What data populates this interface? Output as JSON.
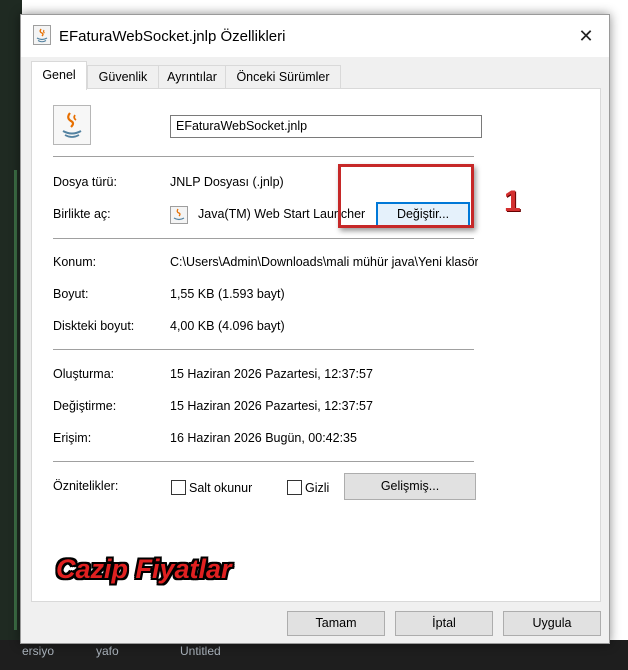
{
  "background": {
    "taskbar_items": [
      "ersiyo",
      "yafo",
      "Untitled"
    ]
  },
  "dialog": {
    "title": "EFaturaWebSocket.jnlp Özellikleri",
    "close_symbol": "✕",
    "tabs": [
      {
        "label": "Genel",
        "active": true
      },
      {
        "label": "Güvenlik",
        "active": false
      },
      {
        "label": "Ayrıntılar",
        "active": false
      },
      {
        "label": "Önceki Sürümler",
        "active": false
      }
    ]
  },
  "general": {
    "file_name": "EFaturaWebSocket.jnlp",
    "file_type_label": "Dosya türü:",
    "file_type_value": "JNLP Dosyası (.jnlp)",
    "opens_with_label": "Birlikte aç:",
    "opens_with_value": "Java(TM) Web Start Launcher",
    "change_button": "Değiştir...",
    "location_label": "Konum:",
    "location_value": "C:\\Users\\Admin\\Downloads\\mali mühür java\\Yeni klasör",
    "size_label": "Boyut:",
    "size_value": "1,55 KB (1.593 bayt)",
    "size_on_disk_label": "Diskteki boyut:",
    "size_on_disk_value": "4,00 KB (4.096 bayt)",
    "created_label": "Oluşturma:",
    "created_value": "15 Haziran 2026 Pazartesi, 12:37:57",
    "modified_label": "Değiştirme:",
    "modified_value": "15 Haziran 2026 Pazartesi, 12:37:57",
    "accessed_label": "Erişim:",
    "accessed_value": "16 Haziran 2026 Bugün, 00:42:35",
    "attributes_label": "Öznitelikler:",
    "readonly_label": "Salt okunur",
    "readonly_checked": false,
    "hidden_label": "Gizli",
    "hidden_checked": false,
    "advanced_button": "Gelişmiş..."
  },
  "footer": {
    "ok_button": "Tamam",
    "cancel_button": "İptal",
    "apply_button": "Uygula"
  },
  "overlay": {
    "annotation_number": "1",
    "annotation_color": "#d32f2f",
    "promo_text": "Cazip Fiyatlar"
  },
  "icons": {
    "title": "java-file-icon",
    "file": "java-file-icon",
    "opens_with": "java-web-start-icon"
  }
}
